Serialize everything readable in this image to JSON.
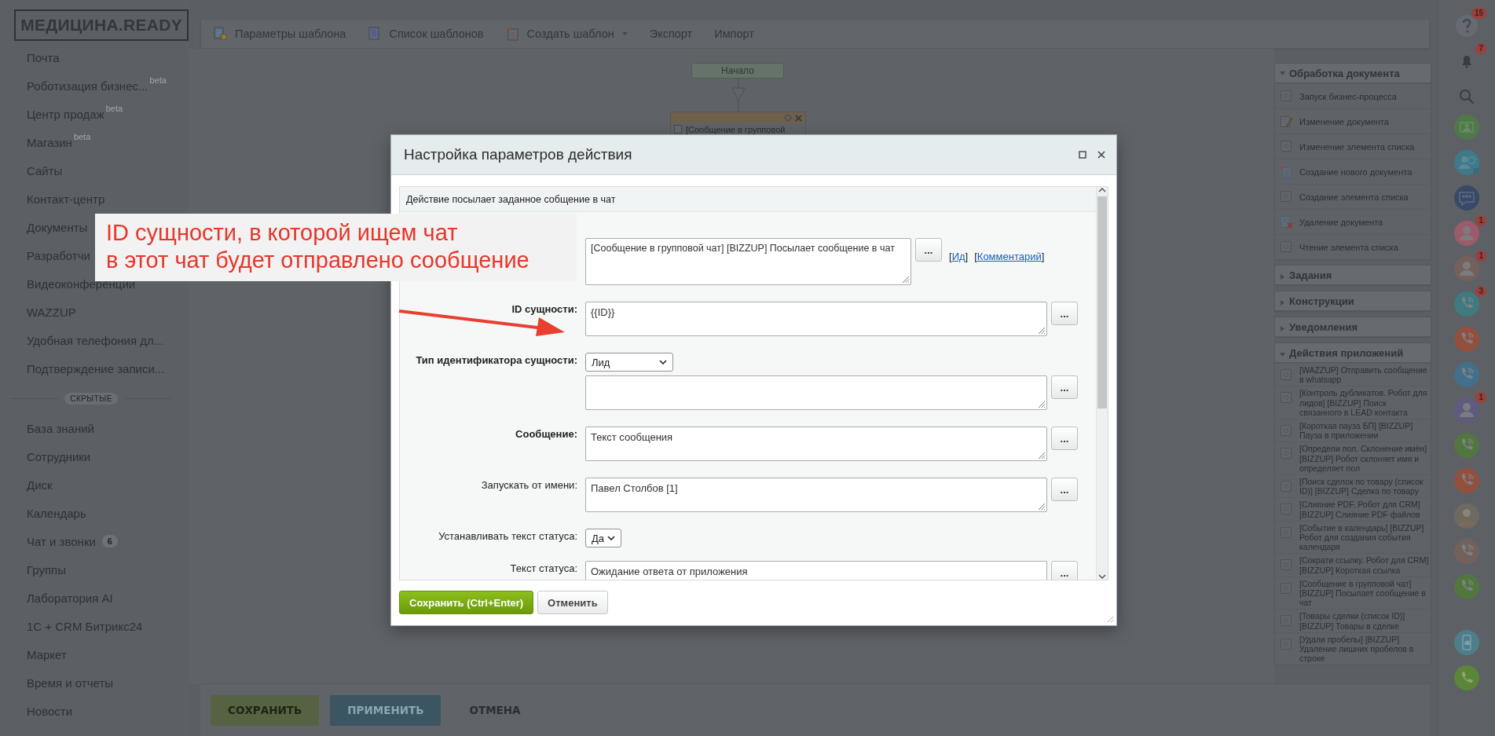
{
  "sidebar": {
    "logo": "МЕДИЦИНА.READY",
    "items": [
      {
        "label": "Почта"
      },
      {
        "label": "Роботизация бизнес...",
        "badge": "beta"
      },
      {
        "label": "Центр продаж",
        "badge": "beta"
      },
      {
        "label": "Магазин",
        "badge": "beta"
      },
      {
        "label": "Сайты"
      },
      {
        "label": "Контакт-центр"
      },
      {
        "label": "Документы"
      },
      {
        "label": "Разработчи"
      },
      {
        "label": "Видеоконференции"
      },
      {
        "label": "WAZZUP"
      },
      {
        "label": "Удобная телефония дл..."
      },
      {
        "label": "Подтверждение записи..."
      }
    ],
    "divider": "СКРЫТЫЕ",
    "hidden_items": [
      {
        "label": "База знаний"
      },
      {
        "label": "Сотрудники"
      },
      {
        "label": "Диск"
      },
      {
        "label": "Календарь"
      },
      {
        "label": "Чат и звонки",
        "counter": "6"
      },
      {
        "label": "Группы"
      },
      {
        "label": "Лаборатория AI"
      },
      {
        "label": "1С + CRM Битрикс24"
      },
      {
        "label": "Маркет"
      },
      {
        "label": "Время и отчеты"
      },
      {
        "label": "Новости"
      }
    ]
  },
  "toolbar": {
    "items": [
      {
        "label": "Параметры шаблона"
      },
      {
        "label": "Список шаблонов"
      },
      {
        "label": "Создать шаблон",
        "dropdown": true
      },
      {
        "label": "Экспорт"
      },
      {
        "label": "Импорт"
      }
    ]
  },
  "canvas": {
    "start_node": "Начало",
    "action_node": "[Сообщение в групповой"
  },
  "activity_panel": {
    "sections": [
      {
        "title": "Обработка документа",
        "expanded": true,
        "items": [
          {
            "label": "Запуск бизнес-процесса"
          },
          {
            "label": "Изменение документа"
          },
          {
            "label": "Изменение элемента списка"
          },
          {
            "label": "Создание нового документа"
          },
          {
            "label": "Создание элемента списка"
          },
          {
            "label": "Удаление документа"
          },
          {
            "label": "Чтение элемента списка"
          }
        ]
      },
      {
        "title": "Задания",
        "expanded": false
      },
      {
        "title": "Конструкции",
        "expanded": false
      },
      {
        "title": "Уведомления",
        "expanded": false
      },
      {
        "title": "Действия приложений",
        "expanded": true,
        "items": [
          {
            "label": "[WAZZUP] Отправить сообщение в whatsapp"
          },
          {
            "label": "[Контроль дубликатов. Робот для лидов] [BIZZUP] Поиск связанного в LEAD контакта"
          },
          {
            "label": "[Короткая пауза БП] [BIZZUP] Пауза в приложении"
          },
          {
            "label": "[Определи пол. Склонение имён] [BIZZUP] Робот склоняет имя и определяет пол"
          },
          {
            "label": "[Поиск сделок по товару (список ID)] [BIZZUP] Сделка по товару"
          },
          {
            "label": "[Слияние PDF. Робот для CRM] [BIZZUP] Слияние PDF файлов"
          },
          {
            "label": "[Событие в календарь] [BIZZUP] Робот для создания события календаря"
          },
          {
            "label": "[Сократи ссылку. Робот для CRM] [BIZZUP] Короткая ссылка"
          },
          {
            "label": "[Сообщение в групповой чат] [BIZZUP] Посылает сообщение в чат"
          },
          {
            "label": "[Товары сделки (список ID)] [BIZZUP] Товары в сделке"
          },
          {
            "label": "[Удали пробелы] [BIZZUP] Удаление лишних пробелов в строке"
          }
        ]
      }
    ]
  },
  "right_rail": {
    "items": [
      {
        "kind": "help",
        "color": "#676b71",
        "badge": "15"
      },
      {
        "kind": "bell",
        "badge": "7"
      },
      {
        "kind": "search"
      },
      {
        "kind": "crm",
        "color": "#4f7a47"
      },
      {
        "kind": "contact",
        "color": "#3f7a8a"
      },
      {
        "kind": "chat",
        "color": "#3a4a66"
      },
      {
        "kind": "person",
        "color": "#9c5a6a",
        "badge": "1"
      },
      {
        "kind": "person",
        "color": "#76605b",
        "badge": "1"
      },
      {
        "kind": "phone",
        "color": "#3f7a80",
        "badge": "3"
      },
      {
        "kind": "phone",
        "color": "#93503f"
      },
      {
        "kind": "phone",
        "color": "#42708c"
      },
      {
        "kind": "person",
        "color": "#5f5a80",
        "badge": "1"
      },
      {
        "kind": "phone",
        "color": "#51773f"
      },
      {
        "kind": "phone",
        "color": "#93503f"
      },
      {
        "kind": "avatar",
        "color": "#6e6a62"
      },
      {
        "kind": "phone",
        "color": "#73615c"
      },
      {
        "kind": "phone",
        "color": "#51773f"
      },
      {
        "kind": "cloud-phone",
        "color": "#4f7e8b"
      },
      {
        "kind": "call",
        "color": "#5b8537"
      }
    ]
  },
  "bottom_bar": {
    "buttons": [
      {
        "label": "СОХРАНИТЬ",
        "kind": "save"
      },
      {
        "label": "ПРИМЕНИТЬ",
        "kind": "apply"
      },
      {
        "label": "ОТМЕНА",
        "kind": "cancel"
      }
    ]
  },
  "dialog": {
    "title": "Настройка параметров действия",
    "description": "Действие посылает заданное собщение в чат",
    "fields": [
      {
        "kind": "textarea",
        "value": "[Сообщение в групповой чат] [BIZZUP] Посылает сообщение в чат",
        "button": "...",
        "links": [
          {
            "prefix": "[",
            "label": "Ид",
            "suffix": "]"
          },
          {
            "prefix": "[",
            "label": "Комментарий",
            "suffix": "]"
          }
        ]
      },
      {
        "kind": "textarea",
        "label": "ID сущности:",
        "required": true,
        "value": "{{ID}}",
        "button": "..."
      },
      {
        "kind": "select",
        "label": "Тип идентификатора сущности:",
        "required": true,
        "value": "Лид"
      },
      {
        "kind": "textarea",
        "button": "..."
      },
      {
        "kind": "textarea",
        "label": "Сообщение:",
        "required": true,
        "value": "Текст сообщения",
        "button": "..."
      },
      {
        "kind": "textarea",
        "label": "Запускать от имени:",
        "required": false,
        "value": "Павел Столбов [1]",
        "button": "..."
      },
      {
        "kind": "select",
        "label": "Устанавливать текст статуса:",
        "required": false,
        "value": "Да"
      },
      {
        "kind": "textarea",
        "label": "Текст статуса:",
        "required": false,
        "value": "Ожидание ответа от приложения",
        "button": "..."
      }
    ],
    "buttons": [
      {
        "label": "Сохранить (Ctrl+Enter)",
        "kind": "primary"
      },
      {
        "label": "Отменить",
        "kind": "secondary"
      }
    ]
  },
  "annotation": {
    "lines": [
      "ID сущности, в которой ищем чат",
      "в этот чат будет отправлено сообщение"
    ]
  }
}
